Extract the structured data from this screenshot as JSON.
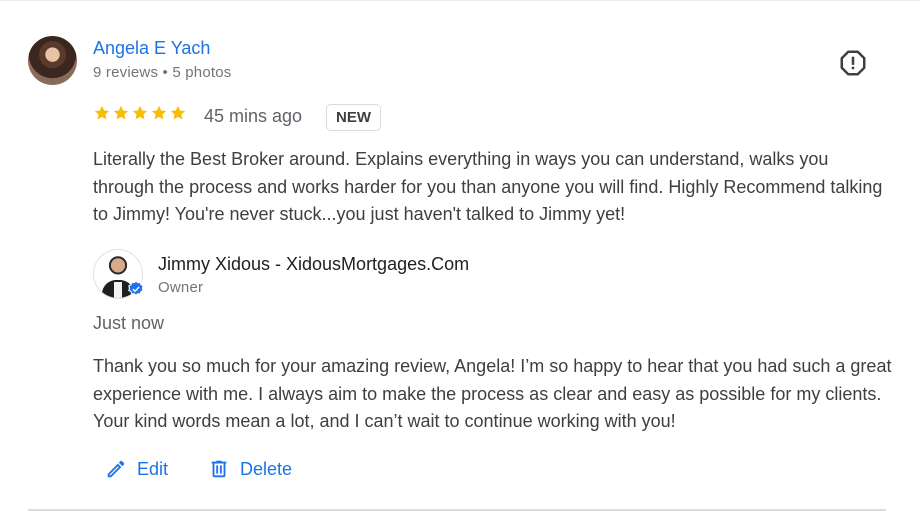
{
  "review": {
    "reviewer_name": "Angela E Yach",
    "reviewer_meta": "9 reviews • 5 photos",
    "rating": 5,
    "time": "45 mins ago",
    "badge": "NEW",
    "text": "Literally the Best Broker around. Explains everything in ways you can understand, walks you through the process and works harder for you than anyone you will find. Highly Recommend talking to Jimmy! You're never stuck...you just haven't talked to Jimmy yet!"
  },
  "reply": {
    "owner_name": "Jimmy Xidous - XidousMortgages.Com",
    "owner_role": "Owner",
    "time": "Just now",
    "text": "Thank you so much for your amazing review, Angela! I’m so happy to hear that you had such a great experience with me. I always aim to make the process as clear and easy as possible for my clients. Your kind words mean a lot, and I can’t wait to continue working with you!"
  },
  "actions": {
    "edit_label": "Edit",
    "delete_label": "Delete"
  },
  "colors": {
    "accent": "#1a73e8",
    "star": "#fbbc04",
    "verified": "#1a73e8"
  }
}
